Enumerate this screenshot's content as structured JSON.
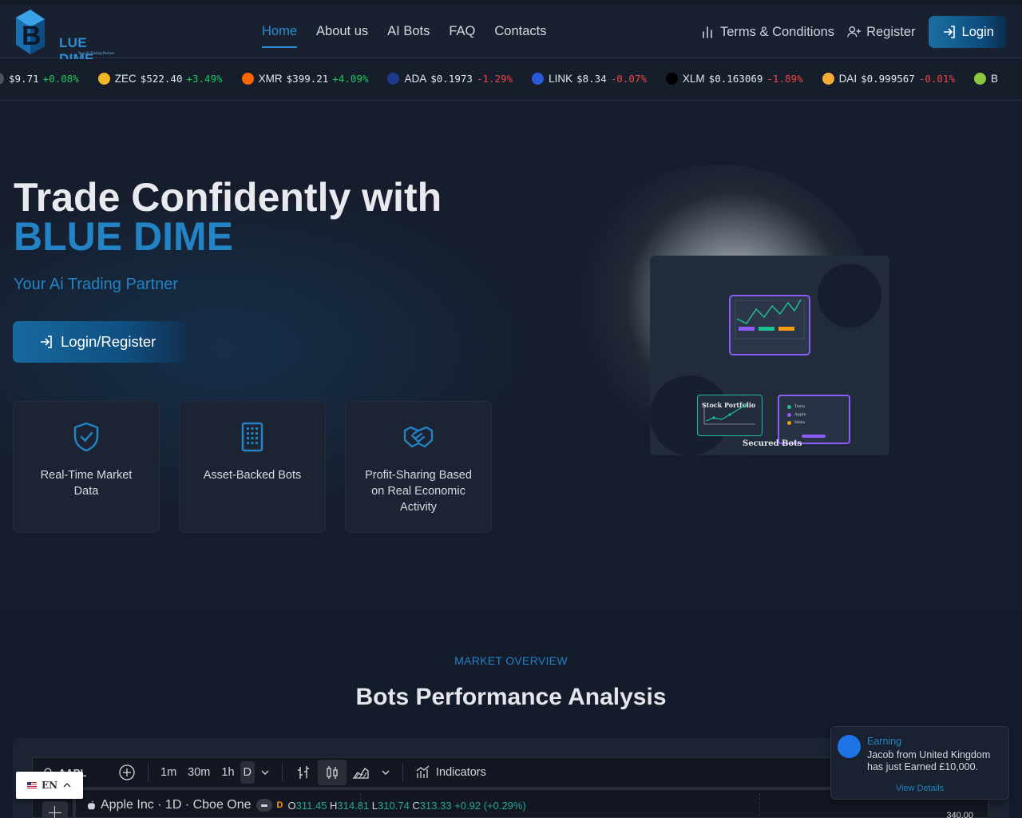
{
  "nav": {
    "brand": "LUE DIME",
    "brand_tagline": "Your AI Trading Partner",
    "menu": [
      {
        "label": "Home",
        "active": true
      },
      {
        "label": "About us",
        "active": false
      },
      {
        "label": "AI Bots",
        "active": false
      },
      {
        "label": "FAQ",
        "active": false
      },
      {
        "label": "Contacts",
        "active": false
      }
    ],
    "terms_label": "Terms & Conditions",
    "register_label": "Register",
    "login_label": "Login"
  },
  "ticker": [
    {
      "symbol": "",
      "price": "$9.71",
      "change": "+0.08%",
      "direction": "up",
      "color": "#4b5563"
    },
    {
      "symbol": "ZEC",
      "price": "$522.40",
      "change": "+3.49%",
      "direction": "up",
      "color": "#f4b728"
    },
    {
      "symbol": "XMR",
      "price": "$399.21",
      "change": "+4.09%",
      "direction": "up",
      "color": "#ff6600"
    },
    {
      "symbol": "ADA",
      "price": "$0.1973",
      "change": "-1.29%",
      "direction": "down",
      "color": "#1e3a8a"
    },
    {
      "symbol": "LINK",
      "price": "$8.34",
      "change": "-0.07%",
      "direction": "down",
      "color": "#2a5ada"
    },
    {
      "symbol": "XLM",
      "price": "$0.163069",
      "change": "-1.89%",
      "direction": "down",
      "color": "#000000"
    },
    {
      "symbol": "DAI",
      "price": "$0.999567",
      "change": "-0.01%",
      "direction": "down",
      "color": "#f5ac37"
    },
    {
      "symbol": "B",
      "price": "",
      "change": "",
      "direction": "up",
      "color": "#8dc63f"
    }
  ],
  "hero": {
    "title_line1": "Trade Confidently with",
    "title_line2": "BLUE DIME",
    "subtitle": "Your Ai Trading Partner",
    "cta_label": "Login/Register",
    "features": [
      {
        "icon": "shield-check-icon",
        "label": "Real-Time Market Data"
      },
      {
        "icon": "building-icon",
        "label": "Asset-Backed Bots"
      },
      {
        "icon": "handshake-icon",
        "label": "Profit-Sharing Based on Real Economic Activity"
      }
    ],
    "illustration": {
      "stock_label": "Stock Portfolio",
      "caption": "Secured Bots",
      "list": [
        "Tesla",
        "Apple",
        "Meta"
      ]
    }
  },
  "market": {
    "tag": "MARKET OVERVIEW",
    "title": "Bots Performance Analysis",
    "chart": {
      "symbol": "AAPL",
      "intervals": [
        "1m",
        "30m",
        "1h",
        "D"
      ],
      "selected_interval": "D",
      "indicators_label": "Indicators",
      "legend_title": "Apple Inc · 1D · Cboe One",
      "legend_flag": "D",
      "open": "311.45",
      "high": "314.81",
      "low": "310.74",
      "close": "313.33",
      "change": "+0.92 (+0.29%)",
      "price_tick": "340.00"
    }
  },
  "lang": {
    "code": "EN"
  },
  "toast": {
    "title": "Earning",
    "message": "Jacob from United Kingdom has just Earned £10,000.",
    "link": "View Details"
  },
  "colors": {
    "accent": "#2383c4",
    "up": "#22c55e",
    "down": "#ef4444",
    "bg": "#151c2c"
  }
}
